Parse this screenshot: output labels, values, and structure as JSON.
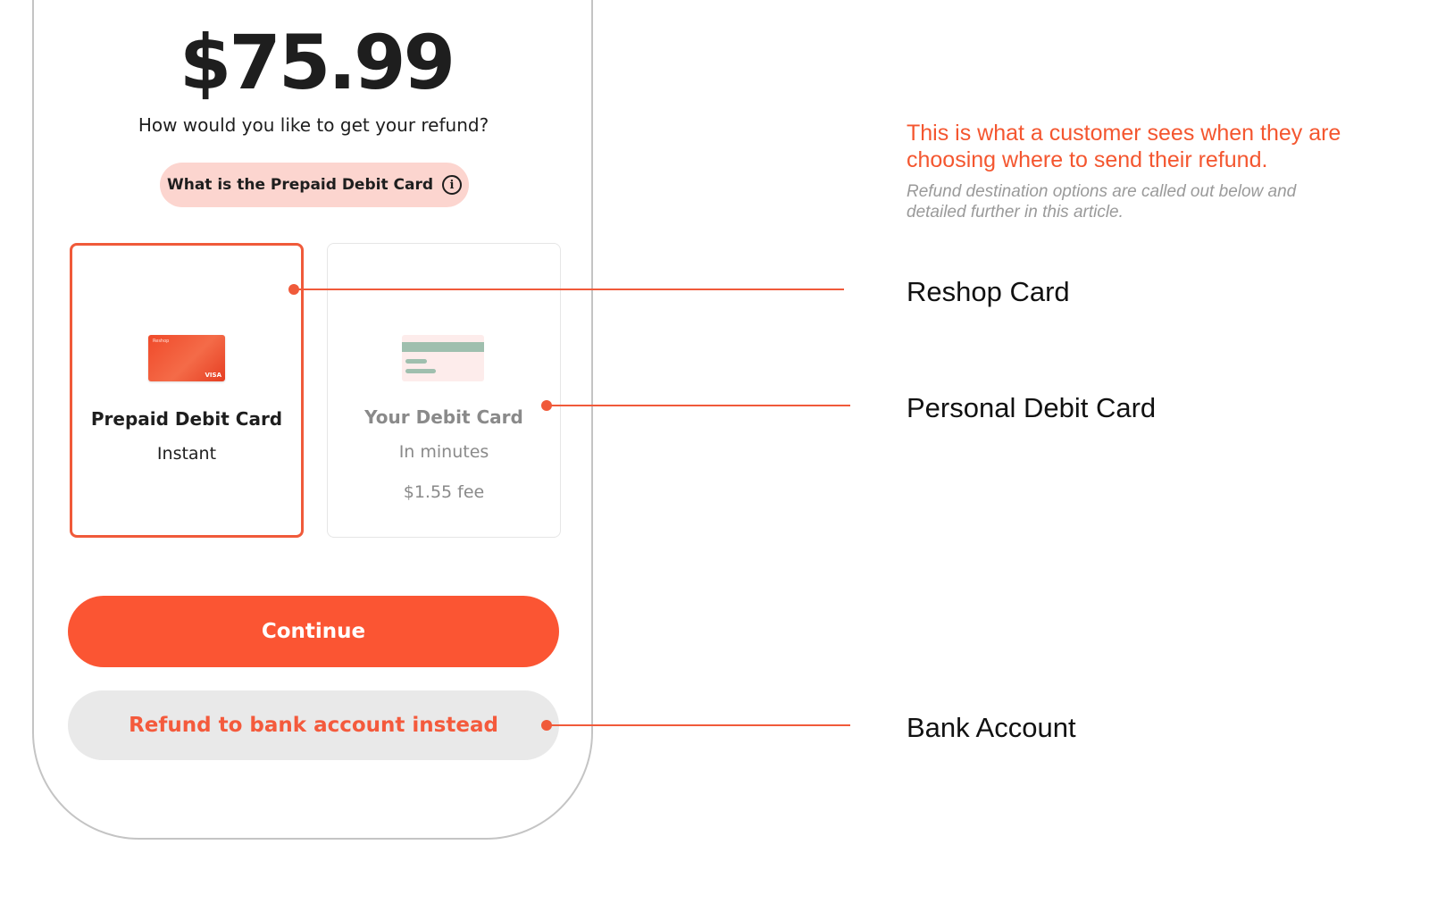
{
  "phone": {
    "amount": "$75.99",
    "question": "How would you like to get your refund?",
    "info_pill_label": "What is the Prepaid Debit Card",
    "info_icon_glyph": "i",
    "options": [
      {
        "title": "Prepaid Debit Card",
        "subtitle": "Instant",
        "selected": true,
        "icon": "prepaid-card-icon",
        "card_brand": "Reshop",
        "card_network": "VISA"
      },
      {
        "title": "Your Debit Card",
        "subtitle": "In minutes",
        "fee": "$1.55 fee",
        "selected": false,
        "icon": "debit-card-icon"
      }
    ],
    "continue_label": "Continue",
    "bank_label": "Refund to bank account instead"
  },
  "annotations": {
    "heading": "This is what a customer sees when they are choosing where to send their refund.",
    "subtext": "Refund destination options are called out below and detailed further in this article.",
    "callouts": [
      {
        "label": "Reshop Card"
      },
      {
        "label": "Personal Debit Card"
      },
      {
        "label": "Bank Account"
      }
    ]
  },
  "colors": {
    "accent": "#fb5533",
    "pill_bg": "#fcd5cf",
    "secondary_bg": "#e9e9e9",
    "muted_text": "#8a8a8a"
  }
}
